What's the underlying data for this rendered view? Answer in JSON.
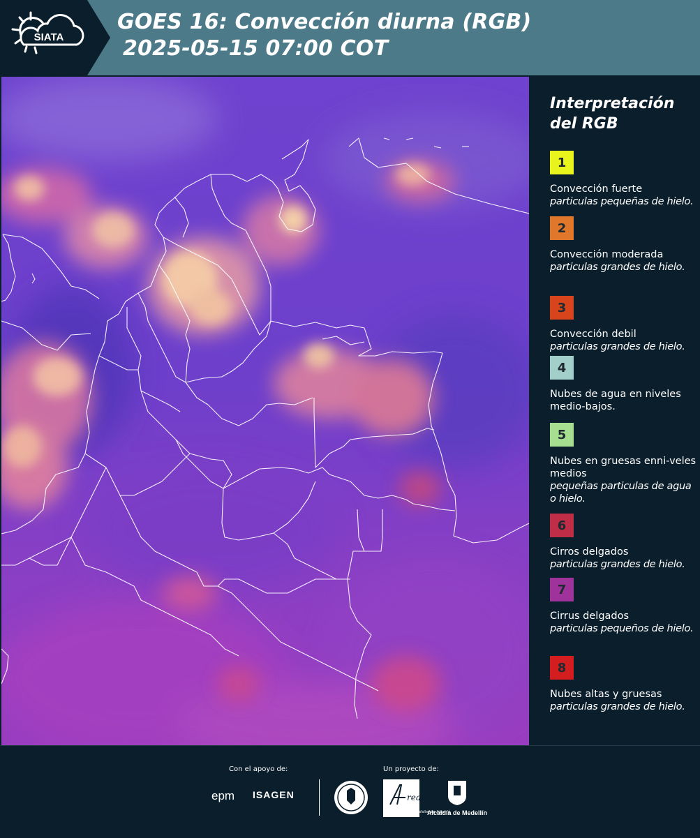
{
  "header": {
    "logo_text": "SIATA",
    "title_line1": "GOES 16: Convección diurna (RGB)",
    "title_line2": "2025-05-15 07:00 COT"
  },
  "legend": {
    "title": "Interpretación del RGB",
    "items": [
      {
        "number": "1",
        "color": "#e8f41c",
        "name": "Convección fuerte",
        "desc": "particulas pequeñas de hielo."
      },
      {
        "number": "2",
        "color": "#e0772a",
        "name": "Convección moderada",
        "desc": "particulas grandes de hielo."
      },
      {
        "number": "3",
        "color": "#d8441c",
        "name": "Convección debil",
        "desc": "particulas grandes de hielo."
      },
      {
        "number": "4",
        "color": "#a3cfcb",
        "name": "Nubes de agua en niveles medio-bajos.",
        "desc": ""
      },
      {
        "number": "5",
        "color": "#a5df8f",
        "name": "Nubes en gruesas enni-veles medios",
        "desc": "pequeñas particulas de agua o hielo."
      },
      {
        "number": "6",
        "color": "#bf2d47",
        "name": "Cirros delgados",
        "desc": "particulas grandes de hielo."
      },
      {
        "number": "7",
        "color": "#a0339b",
        "name": "Cirrus delgados",
        "desc": "particulas pequeños de hielo."
      },
      {
        "number": "8",
        "color": "#d41d1f",
        "name": "Nubes altas y gruesas",
        "desc": "particulas grandes de hielo."
      }
    ]
  },
  "footer": {
    "support_label": "Con el apoyo de:",
    "project_label": "Un proyecto de:",
    "sponsor1": "epm",
    "sponsor2": "ISAGEN",
    "partner1": "METROPOLITANA Valle de Aburrá",
    "partner2": "Alcaldía de Medellín"
  }
}
